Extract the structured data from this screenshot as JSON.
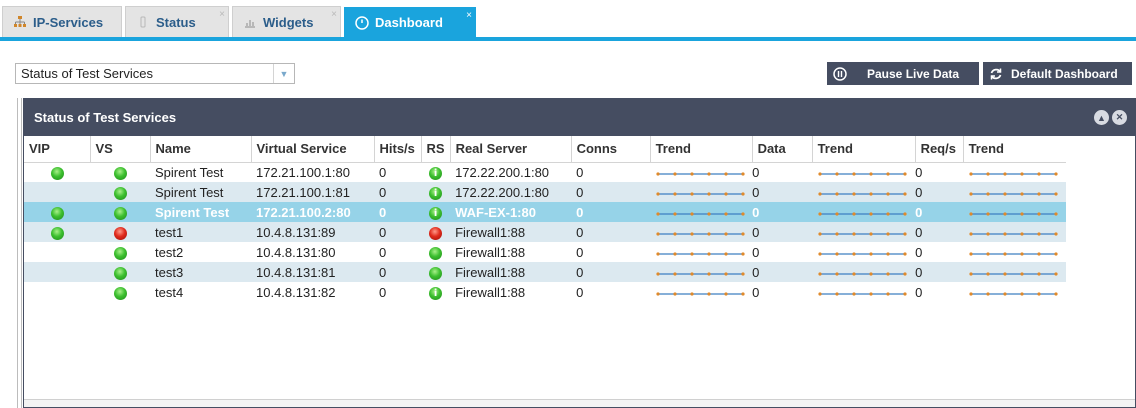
{
  "tabs": [
    {
      "label": "IP-Services",
      "icon": "network-tree-icon",
      "closable": false
    },
    {
      "label": "Status",
      "icon": "status-icon",
      "closable": true
    },
    {
      "label": "Widgets",
      "icon": "widgets-icon",
      "closable": true
    },
    {
      "label": "Dashboard",
      "icon": "dashboard-gauge-icon",
      "closable": true,
      "active": true
    }
  ],
  "tab_close_glyph": "×",
  "toolbar": {
    "select_value": "Status of Test Services",
    "pause_label": "Pause Live Data",
    "default_label": "Default Dashboard"
  },
  "panel": {
    "title": "Status of Test Services"
  },
  "table": {
    "headers": [
      "VIP",
      "VS",
      "Name",
      "Virtual Service",
      "Hits/s",
      "RS",
      "Real Server",
      "Conns",
      "Trend",
      "Data",
      "Trend",
      "Req/s",
      "Trend"
    ],
    "rows": [
      {
        "vip": "green",
        "vs": "green",
        "name": "Spirent Test",
        "virtual_service": "172.21.100.1:80",
        "hits": "0",
        "rs": "info",
        "real_server": "172.22.200.1:80",
        "conns": "0",
        "data": "0",
        "reqs": "0",
        "style": "plain"
      },
      {
        "vip": "",
        "vs": "green",
        "name": "Spirent Test",
        "virtual_service": "172.21.100.1:81",
        "hits": "0",
        "rs": "info",
        "real_server": "172.22.200.1:80",
        "conns": "0",
        "data": "0",
        "reqs": "0",
        "style": "alt"
      },
      {
        "vip": "green",
        "vs": "green",
        "name": "Spirent Test",
        "virtual_service": "172.21.100.2:80",
        "hits": "0",
        "rs": "info",
        "real_server": "WAF-EX-1:80",
        "conns": "0",
        "data": "0",
        "reqs": "0",
        "style": "sel"
      },
      {
        "vip": "green",
        "vs": "red",
        "name": "test1",
        "virtual_service": "10.4.8.131:89",
        "hits": "0",
        "rs": "red",
        "real_server": "Firewall1:88",
        "conns": "0",
        "data": "0",
        "reqs": "0",
        "style": "alt"
      },
      {
        "vip": "",
        "vs": "green",
        "name": "test2",
        "virtual_service": "10.4.8.131:80",
        "hits": "0",
        "rs": "green",
        "real_server": "Firewall1:88",
        "conns": "0",
        "data": "0",
        "reqs": "0",
        "style": "plain"
      },
      {
        "vip": "",
        "vs": "green",
        "name": "test3",
        "virtual_service": "10.4.8.131:81",
        "hits": "0",
        "rs": "green",
        "real_server": "Firewall1:88",
        "conns": "0",
        "data": "0",
        "reqs": "0",
        "style": "alt"
      },
      {
        "vip": "",
        "vs": "green",
        "name": "test4",
        "virtual_service": "10.4.8.131:82",
        "hits": "0",
        "rs": "info",
        "real_server": "Firewall1:88",
        "conns": "0",
        "data": "0",
        "reqs": "0",
        "style": "plain"
      }
    ]
  },
  "colors": {
    "accent": "#1aa4dd",
    "panel_header": "#454d61",
    "row_alt": "#dce9f0",
    "row_selected": "#96d3e8",
    "spark_line": "#3d7fc1",
    "spark_dot": "#e08a2b"
  }
}
